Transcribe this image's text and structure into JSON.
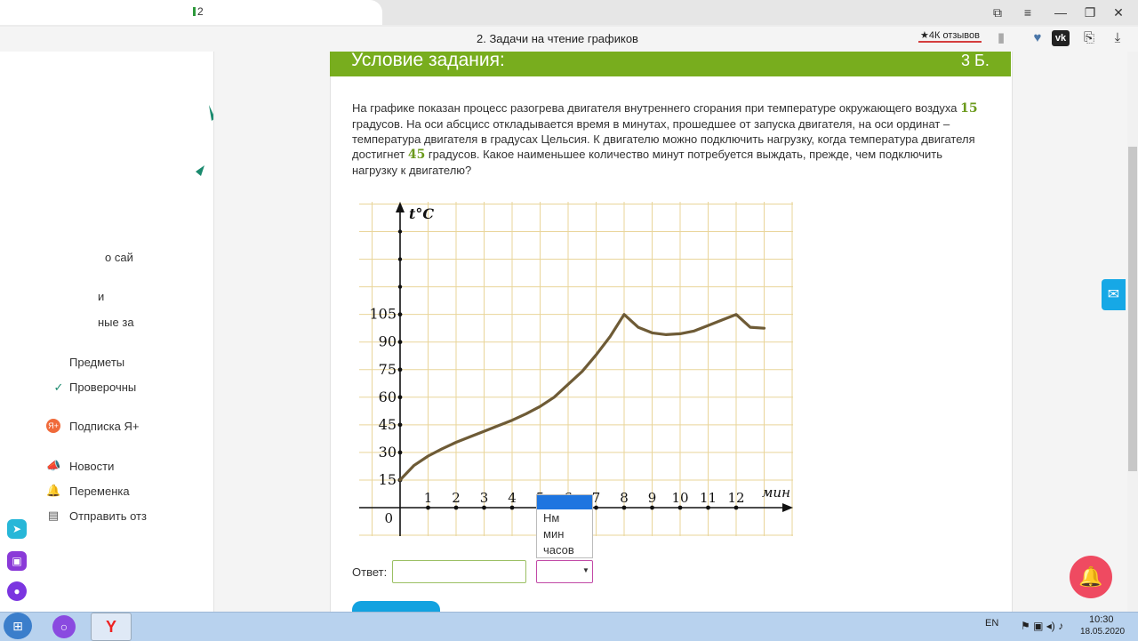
{
  "browser": {
    "tab_number": "2",
    "page_title": "2. Задачи на чтение графиков",
    "reviews_badge": "★4К отзывов",
    "icons": [
      "bookmark-manager-icon",
      "menu-icon",
      "minimize-icon",
      "restore-icon",
      "close-icon",
      "bookmark-icon",
      "heart-icon",
      "vk-icon",
      "chat-icon",
      "download-icon"
    ],
    "window_controls": {
      "menu": "≡",
      "minimize": "—",
      "restore": "❐",
      "close": "✕"
    }
  },
  "sidebar": {
    "items": [
      {
        "label": "о сай"
      },
      {
        "label": "и"
      },
      {
        "label": "ные за"
      },
      {
        "label": "Предметы"
      },
      {
        "label": "Проверочны"
      },
      {
        "label": "Подписка Я+"
      },
      {
        "label": "Новости"
      },
      {
        "label": "Переменка"
      },
      {
        "label": "Отправить отз"
      }
    ],
    "accent_color": "#1a8a6e"
  },
  "task": {
    "heading": "Условие задания:",
    "points": "3 Б.",
    "text_1": "На графике показан процесс разогрева двигателя внутреннего сгорания при температуре окружающего воздуха ",
    "ambient_temp": "15",
    "text_2": " градусов. На оси абсцисс откладывается время в минутах, прошедшее от запуска двигателя, на оси ординат – температура двигателя в градусах Цельсия. К двигателю можно подключить нагрузку, когда температура двигателя достигнет ",
    "target_temp": "45",
    "text_3": " градусов. Какое наименьшее количество минут потребуется выждать, прежде, чем подключить нагрузку к двигателю?",
    "header_color": "#78ad1e"
  },
  "chart_data": {
    "type": "line",
    "ylabel": "t°C",
    "xlabel": "мин",
    "origin_label": "0",
    "x_ticks": [
      "1",
      "2",
      "3",
      "4",
      "5",
      "6",
      "7",
      "8",
      "9",
      "10",
      "11",
      "12"
    ],
    "y_ticks": [
      "15",
      "30",
      "45",
      "60",
      "75",
      "90",
      "105"
    ],
    "xlim": [
      0,
      13.5
    ],
    "ylim": [
      0,
      150
    ],
    "grid": true,
    "series": [
      {
        "x": [
          0,
          0.5,
          1,
          1.5,
          2,
          2.5,
          3,
          3.5,
          4,
          4.5,
          5,
          5.5,
          6,
          6.5,
          7,
          7.5,
          8,
          8.5,
          9,
          9.5,
          10,
          10.5,
          11,
          11.5,
          12,
          12.5,
          13
        ],
        "y": [
          15,
          23,
          28,
          32,
          35.5,
          38.5,
          41.5,
          44.5,
          47.5,
          51,
          55,
          60,
          67,
          74,
          83,
          93,
          105,
          98,
          95,
          94,
          94.5,
          96,
          99,
          102,
          105,
          98,
          97.5
        ],
        "color": "#6e5b36"
      }
    ]
  },
  "answer": {
    "label": "Ответ:",
    "input_value": "",
    "unit_options": [
      "Нм",
      "мин",
      "часов"
    ],
    "selected_unit": ""
  },
  "taskbar": {
    "lang": "EN",
    "time": "10:30",
    "date": "18.05.2020"
  }
}
